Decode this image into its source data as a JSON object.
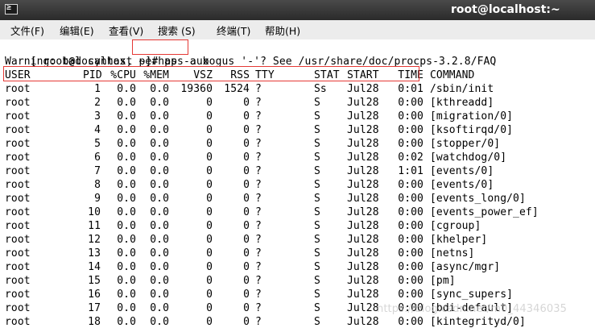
{
  "window": {
    "title": "root@localhost:~",
    "icon": "terminal-icon",
    "icon_glyph": "≥"
  },
  "menu": [
    {
      "name": "menu-file",
      "label": "文件(F)"
    },
    {
      "name": "menu-edit",
      "label": "编辑(E)"
    },
    {
      "name": "menu-view",
      "label": "查看(V)"
    },
    {
      "name": "menu-search",
      "label": "搜索 (S)"
    },
    {
      "name": "menu-terminal",
      "label": "终端(T)"
    },
    {
      "name": "menu-help",
      "label": "帮助(H)"
    }
  ],
  "terminal": {
    "prompt": "[ root@localhost ~]# ",
    "command": "ps -aux",
    "warning": "Warning: bad syntax, perhaps a bogus '-'? See /usr/share/doc/procps-3.2.8/FAQ",
    "headers": [
      "USER",
      "PID",
      "%CPU",
      "%MEM",
      "VSZ",
      "RSS",
      "TTY",
      "STAT",
      "START",
      "TIME",
      "COMMAND"
    ],
    "rows": [
      [
        "root",
        "1",
        "0.0",
        "0.0",
        "19360",
        "1524",
        "?",
        "Ss",
        "Jul28",
        "0:01",
        "/sbin/init"
      ],
      [
        "root",
        "2",
        "0.0",
        "0.0",
        "0",
        "0",
        "?",
        "S",
        "Jul28",
        "0:00",
        "[kthreadd]"
      ],
      [
        "root",
        "3",
        "0.0",
        "0.0",
        "0",
        "0",
        "?",
        "S",
        "Jul28",
        "0:00",
        "[migration/0]"
      ],
      [
        "root",
        "4",
        "0.0",
        "0.0",
        "0",
        "0",
        "?",
        "S",
        "Jul28",
        "0:00",
        "[ksoftirqd/0]"
      ],
      [
        "root",
        "5",
        "0.0",
        "0.0",
        "0",
        "0",
        "?",
        "S",
        "Jul28",
        "0:00",
        "[stopper/0]"
      ],
      [
        "root",
        "6",
        "0.0",
        "0.0",
        "0",
        "0",
        "?",
        "S",
        "Jul28",
        "0:02",
        "[watchdog/0]"
      ],
      [
        "root",
        "7",
        "0.0",
        "0.0",
        "0",
        "0",
        "?",
        "S",
        "Jul28",
        "1:01",
        "[events/0]"
      ],
      [
        "root",
        "8",
        "0.0",
        "0.0",
        "0",
        "0",
        "?",
        "S",
        "Jul28",
        "0:00",
        "[events/0]"
      ],
      [
        "root",
        "9",
        "0.0",
        "0.0",
        "0",
        "0",
        "?",
        "S",
        "Jul28",
        "0:00",
        "[events_long/0]"
      ],
      [
        "root",
        "10",
        "0.0",
        "0.0",
        "0",
        "0",
        "?",
        "S",
        "Jul28",
        "0:00",
        "[events_power_ef]"
      ],
      [
        "root",
        "11",
        "0.0",
        "0.0",
        "0",
        "0",
        "?",
        "S",
        "Jul28",
        "0:00",
        "[cgroup]"
      ],
      [
        "root",
        "12",
        "0.0",
        "0.0",
        "0",
        "0",
        "?",
        "S",
        "Jul28",
        "0:00",
        "[khelper]"
      ],
      [
        "root",
        "13",
        "0.0",
        "0.0",
        "0",
        "0",
        "?",
        "S",
        "Jul28",
        "0:00",
        "[netns]"
      ],
      [
        "root",
        "14",
        "0.0",
        "0.0",
        "0",
        "0",
        "?",
        "S",
        "Jul28",
        "0:00",
        "[async/mgr]"
      ],
      [
        "root",
        "15",
        "0.0",
        "0.0",
        "0",
        "0",
        "?",
        "S",
        "Jul28",
        "0:00",
        "[pm]"
      ],
      [
        "root",
        "16",
        "0.0",
        "0.0",
        "0",
        "0",
        "?",
        "S",
        "Jul28",
        "0:00",
        "[sync_supers]"
      ],
      [
        "root",
        "17",
        "0.0",
        "0.0",
        "0",
        "0",
        "?",
        "S",
        "Jul28",
        "0:00",
        "[bdi-default]"
      ],
      [
        "root",
        "18",
        "0.0",
        "0.0",
        "0",
        "0",
        "?",
        "S",
        "Jul28",
        "0:00",
        "[kintegrityd/0]"
      ]
    ]
  },
  "highlight_color": "#e53935",
  "watermark": "https://blog.csdn.net/m0_44346035"
}
